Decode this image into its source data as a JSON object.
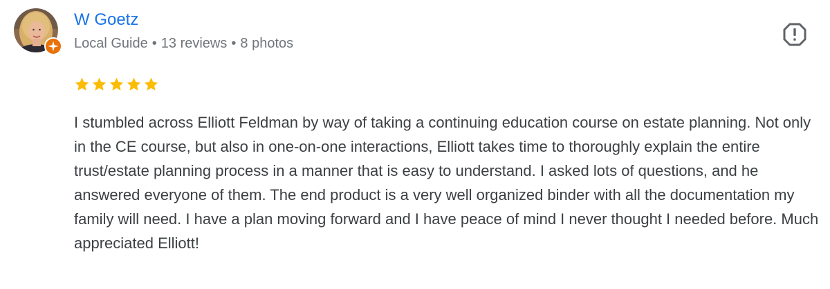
{
  "author": {
    "name": "W Goetz",
    "level": "Local Guide",
    "reviews": "13 reviews",
    "photos": "8 photos",
    "separator": "•",
    "avatar_icon": "profile-photo",
    "badge_icon": "local-guide-star-badge"
  },
  "rating": {
    "stars": 5,
    "max": 5,
    "star_color": "#fbbc04"
  },
  "flag": {
    "icon": "report-flag-icon"
  },
  "review": {
    "text": "I stumbled across Elliott Feldman by way of taking a continuing education course on estate planning. Not only in the CE course, but also in one-on-one interactions, Elliott takes time to thoroughly explain the entire trust/estate planning process in a manner that is easy to understand. I asked lots of questions, and he answered everyone of them. The end product is a very well organized binder with all the documentation my family will need. I have a plan moving forward and I have peace of mind I never thought I needed before. Much appreciated Elliott!"
  },
  "colors": {
    "name_link": "#1a73e8",
    "meta": "#70757a",
    "body_text": "#3c4043",
    "badge": "#e8710a"
  }
}
